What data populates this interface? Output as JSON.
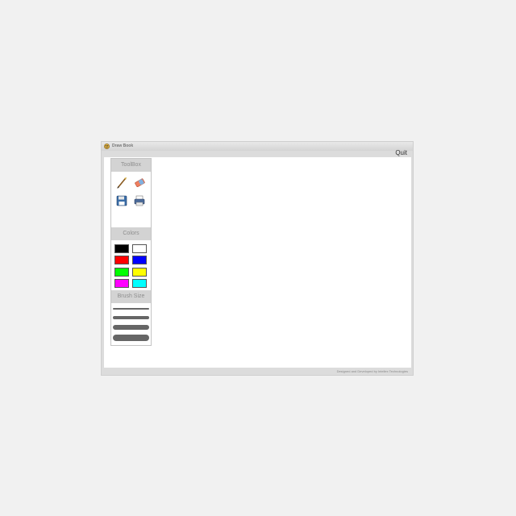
{
  "window": {
    "title": "Draw Book",
    "icon": "paint-palette-icon"
  },
  "menu": {
    "quit_label": "Quit"
  },
  "toolbox": {
    "header": "ToolBox",
    "tools": [
      {
        "name": "brush-icon"
      },
      {
        "name": "eraser-icon"
      },
      {
        "name": "save-icon"
      },
      {
        "name": "print-icon"
      }
    ]
  },
  "colors": {
    "header": "Colors",
    "swatches": [
      "#000000",
      "#ffffff",
      "#ff0000",
      "#0000ff",
      "#00ff00",
      "#ffff00",
      "#ff00ff",
      "#00ffff"
    ]
  },
  "brush_size": {
    "header": "Brush Size",
    "sizes": [
      "1",
      "2",
      "3",
      "4"
    ]
  },
  "footer": {
    "credit": "Designed and Developed by Intellex Technologies"
  }
}
